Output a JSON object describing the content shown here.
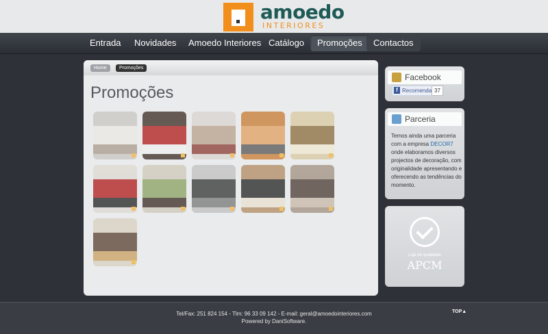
{
  "logo": {
    "name": "amoedo",
    "sub": "INTERIORES"
  },
  "nav": [
    "Entrada",
    "Novidades",
    "Amoedo Interiores",
    "Catálogo",
    "Promoções",
    "Contactos"
  ],
  "breadcrumb": {
    "home": "Home",
    "current": "Promoções"
  },
  "page_title": "Promoções",
  "thumbnails": [
    {
      "alt": "Promoção 1",
      "colors": [
        "#c9c6c0",
        "#ece9e4",
        "#a89a8c"
      ]
    },
    {
      "alt": "Promoção 2",
      "colors": [
        "#3a2a22",
        "#b01a1a",
        "#efefef"
      ]
    },
    {
      "alt": "Promoção 3",
      "colors": [
        "#d9d4cf",
        "#b8a08a",
        "#8a3a30"
      ]
    },
    {
      "alt": "Promoção 4",
      "colors": [
        "#c87a30",
        "#e0a060",
        "#555"
      ]
    },
    {
      "alt": "Promoção 5",
      "colors": [
        "#d9c9a0",
        "#8a6a3a",
        "#f0e8d0"
      ]
    },
    {
      "alt": "Promoção 6",
      "colors": [
        "#ddd8d0",
        "#b01a1a",
        "#222"
      ]
    },
    {
      "alt": "Promoção 7",
      "colors": [
        "#cfc8b8",
        "#8aa060",
        "#3a2a22"
      ]
    },
    {
      "alt": "Promoção 8",
      "colors": [
        "#c0c0c0",
        "#333",
        "#777"
      ]
    },
    {
      "alt": "Promoção 9",
      "colors": [
        "#b08a60",
        "#222",
        "#e8e0d0"
      ]
    },
    {
      "alt": "Promoção 10",
      "colors": [
        "#a09080",
        "#4a3a30",
        "#c8b8a8"
      ]
    },
    {
      "alt": "Promoção 11",
      "colors": [
        "#d9d0c0",
        "#5a4030",
        "#c8a060"
      ]
    }
  ],
  "facebook": {
    "title": "Facebook",
    "button": "Recomendar",
    "count": "37"
  },
  "parceria": {
    "title": "Parceria",
    "text_before": "Temos ainda uma parceria com a empresa",
    "link": "DECOR7",
    "text_after": "onde elaboramos diversos projectos de decoração, com originalidade apresentando e oferecendo as tendências do momento."
  },
  "quality": {
    "caption": "Loja de qualidade",
    "name": "APCM"
  },
  "footer": {
    "contact": "Tel/Fax: 251 824 154 - Tlm: 96 33 09 142 - E-mail: geral@amoedointeriores.com",
    "powered": "Powered by DaniSoftware.",
    "top": "TOP"
  }
}
